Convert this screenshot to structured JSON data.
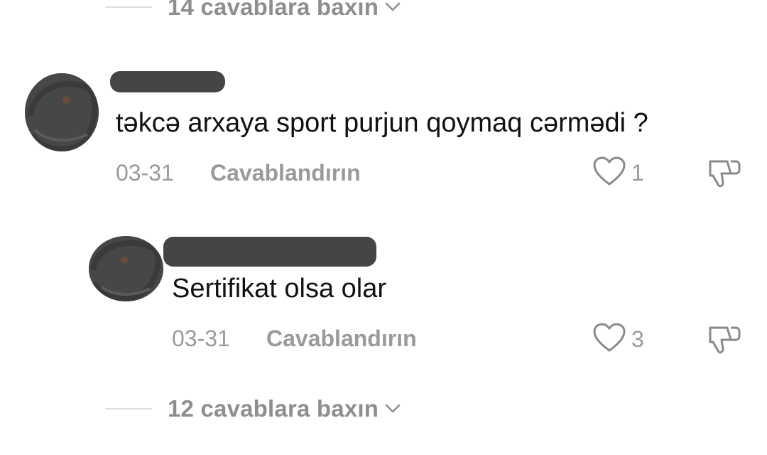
{
  "top_thread": {
    "view_replies_label": "14 cavablara baxın"
  },
  "comment": {
    "text": "təkcə arxaya sport purjun qoymaq cərmədi ?",
    "date": "03-31",
    "reply_label": "Cavablandırın",
    "like_count": "1"
  },
  "reply": {
    "text": "Sertifikat olsa olar",
    "date": "03-31",
    "reply_label": "Cavablandırın",
    "like_count": "3"
  },
  "bottom_thread": {
    "view_replies_label": "12 cavablara baxın"
  },
  "icons": {
    "like": "heart-outline-icon",
    "dislike": "thumbs-down-icon",
    "expand": "chevron-down-icon"
  },
  "colors": {
    "text_primary": "#111111",
    "text_secondary": "#9a9a9a",
    "divider": "#dedede",
    "redaction": "#454545"
  }
}
